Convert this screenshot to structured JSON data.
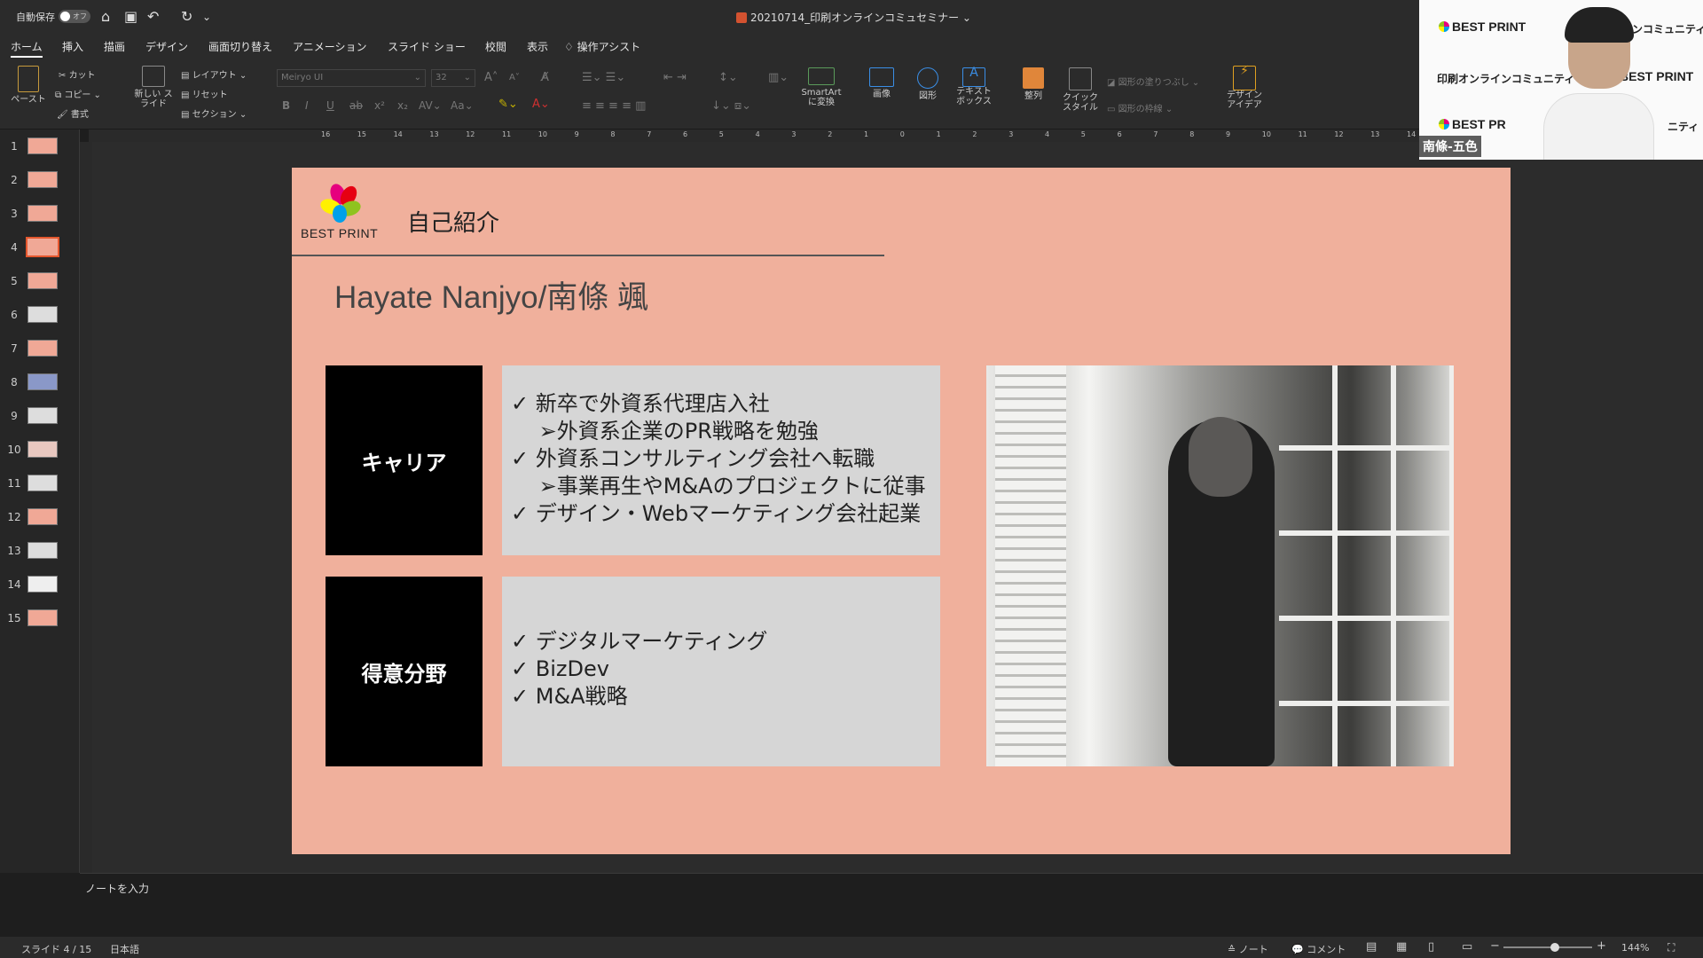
{
  "titlebar": {
    "autosave_label": "自動保存",
    "autosave_state": "オフ",
    "doc_title": "20210714_印刷オンラインコミュセミナー"
  },
  "tabs": [
    "ホーム",
    "挿入",
    "描画",
    "デザイン",
    "画面切り替え",
    "アニメーション",
    "スライド ショー",
    "校閲",
    "表示",
    "操作アシスト"
  ],
  "ribbon": {
    "paste": "ペースト",
    "cut": "カット",
    "copy": "コピー",
    "format": "書式",
    "new_slide": "新しい スライド",
    "layout": "レイアウト",
    "reset": "リセット",
    "section": "セクション",
    "font_name": "Meiryo UI",
    "font_size": "32",
    "smartart": "SmartArt に変換",
    "picture": "画像",
    "shape": "図形",
    "textbox": "テキスト ボックス",
    "arrange": "整列",
    "quick_styles": "クイック スタイル",
    "shape_fill": "図形の塗りつぶし",
    "shape_outline": "図形の枠線",
    "design_ideas": "デザイン アイデア"
  },
  "thumbnails": [
    "1",
    "2",
    "3",
    "4",
    "5",
    "6",
    "7",
    "8",
    "9",
    "10",
    "11",
    "12",
    "13",
    "14",
    "15"
  ],
  "selected_slide": 4,
  "ruler_labels": [
    "16",
    "15",
    "14",
    "13",
    "12",
    "11",
    "10",
    "9",
    "8",
    "7",
    "6",
    "5",
    "4",
    "3",
    "2",
    "1",
    "0",
    "1",
    "2",
    "3",
    "4",
    "5",
    "6",
    "7",
    "8",
    "9",
    "10",
    "11",
    "12",
    "13",
    "14",
    "15",
    "16"
  ],
  "slide": {
    "logo_text": "BEST PRINT",
    "title": "自己紹介",
    "name": "Hayate Nanjyo/南條 颯",
    "career_label": "キャリア",
    "career_items": [
      "✓  新卒で外資系代理店入社",
      "　 ➢外資系企業のPR戦略を勉強",
      "✓  外資系コンサルティング会社へ転職",
      "　 ➢事業再生やM&Aのプロジェクトに従事",
      "✓  デザイン・Webマーケティング会社起業"
    ],
    "skills_label": "得意分野",
    "skills_items": [
      "✓  デジタルマーケティング",
      "✓  BizDev",
      "✓  M&A戦略"
    ]
  },
  "notes_placeholder": "ノートを入力",
  "status": {
    "slide_counter": "スライド 4 / 15",
    "language": "日本語",
    "notes": "ノート",
    "comments": "コメント",
    "zoom": "144%"
  },
  "video": {
    "logo1": "BEST PRINT",
    "community1": "インコミュニティ",
    "community2": "印刷オンラインコミュニティ",
    "logo2": "BEST PRINT",
    "logo3": "BEST PR",
    "community3": "ニティ",
    "participant_name": "南條-五色"
  },
  "colors": {
    "slide_bg": "#f0b09c",
    "accent_tab_selection": "#e4572e"
  }
}
